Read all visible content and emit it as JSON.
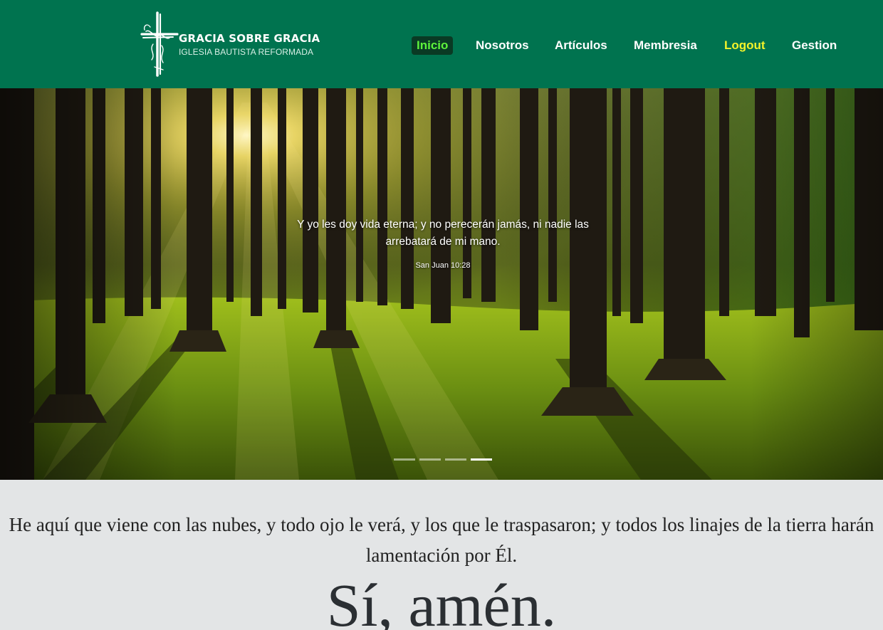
{
  "logo": {
    "title": "GRACIA SOBRE GRACIA",
    "subtitle": "IGLESIA BAUTISTA REFORMADA",
    "icon": "cross-icon"
  },
  "nav": {
    "items": [
      {
        "label": "Inicio",
        "state": "active"
      },
      {
        "label": "Nosotros",
        "state": "normal"
      },
      {
        "label": "Artículos",
        "state": "normal"
      },
      {
        "label": "Membresia",
        "state": "normal"
      },
      {
        "label": "Logout",
        "state": "highlight"
      },
      {
        "label": "Gestion",
        "state": "normal"
      }
    ]
  },
  "hero": {
    "quote": "Y yo les doy vida eterna; y no perecerán jamás, ni nadie las arrebatará de mi mano.",
    "reference": "San Juan 10:28",
    "slides_total": 4,
    "active_slide": 4
  },
  "section": {
    "verse": "He aquí que viene con las nubes, y todo ojo le verá, y los que le traspasaron; y todos los linajes de la tierra harán lamentación por Él.",
    "amen": "Sí, amén."
  },
  "colors": {
    "header_bg": "#00734f",
    "active_nav_text": "#5df23c",
    "active_nav_bg": "#0a3a24",
    "logout_text": "#f3f32a",
    "section_bg": "#e3e5e6"
  }
}
